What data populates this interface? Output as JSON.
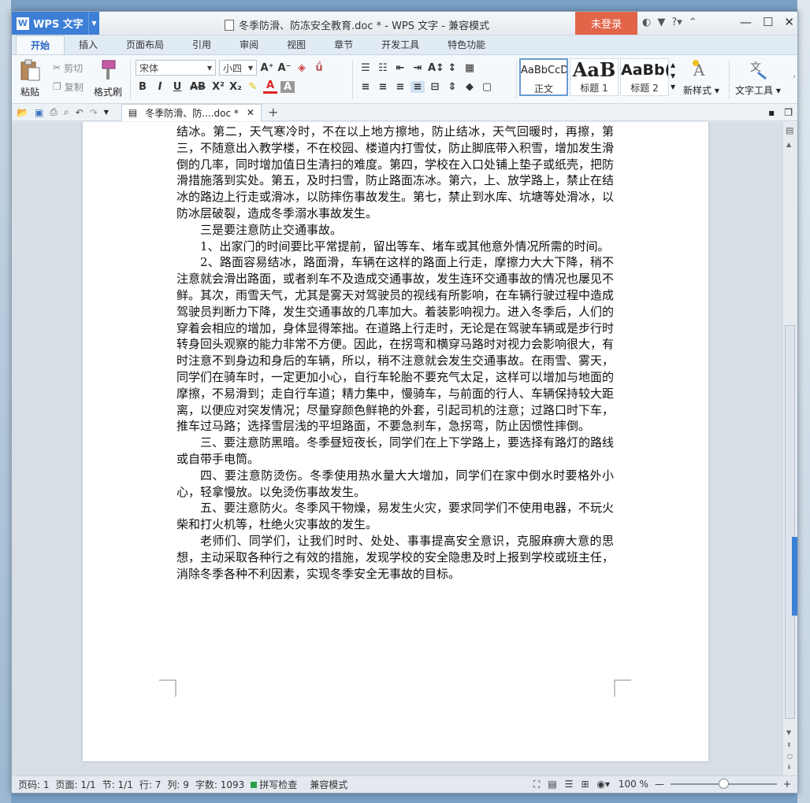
{
  "titlebar": {
    "app_name": "WPS 文字",
    "doc_title": "冬季防滑、防冻安全教育.doc * - WPS 文字 - 兼容模式",
    "login_label": "未登录",
    "help_label": "?"
  },
  "tabs": [
    "开始",
    "插入",
    "页面布局",
    "引用",
    "审阅",
    "视图",
    "章节",
    "开发工具",
    "特色功能"
  ],
  "ribbon": {
    "paste_label": "粘贴",
    "cut_label": "剪切",
    "copy_label": "复制",
    "format_painter_label": "格式刷",
    "font_name": "宋体",
    "font_size": "小四",
    "styles": [
      {
        "preview": "AaBbCcD",
        "name": "正文"
      },
      {
        "preview": "AaB",
        "name": "标题 1"
      },
      {
        "preview": "AaBb(",
        "name": "标题 2"
      }
    ],
    "new_style_label": "新样式",
    "text_tools_label": "文字工具"
  },
  "doc_tab": {
    "label": "冬季防滑、防....doc *"
  },
  "document": {
    "paragraphs": [
      {
        "text": "结冰。第二，天气寒冷时，不在以上地方擦地，防止结冰，天气回暖时，再擦，第三，不随意出入教学楼，不在校园、楼道内打雪仗，防止脚底带入积雪，增加发生滑倒的几率，同时增加值日生清扫的难度。第四，学校在入口处铺上垫子或纸壳，把防滑措施落到实处。第五，及时扫雪，防止路面冻冰。第六，上、放学路上，禁止在结冰的路边上行走或滑冰，以防摔伤事故发生。第七，禁止到水库、坑塘等处滑冰，以防冰层破裂，造成冬季溺水事故发生。",
        "indent": false
      },
      {
        "text": "三是要注意防止交通事故。",
        "indent": true
      },
      {
        "text": "1、出家门的时间要比平常提前，留出等车、堵车或其他意外情况所需的时间。",
        "indent": true
      },
      {
        "text": "2、路面容易结冰，路面滑，车辆在这样的路面上行走，摩擦力大大下降，稍不注意就会滑出路面，或者刹车不及造成交通事故，发生连环交通事故的情况也屡见不鲜。其次，雨雪天气，尤其是雾天对驾驶员的视线有所影响，在车辆行驶过程中造成驾驶员判断力下降，发生交通事故的几率加大。着装影响视力。进入冬季后，人们的穿着会相应的增加，身体显得笨拙。在道路上行走时，无论是在驾驶车辆或是步行时转身回头观察的能力非常不方便。因此，在拐弯和横穿马路时对视力会影响很大，有时注意不到身边和身后的车辆，所以，稍不注意就会发生交通事故。在雨雪、雾天，同学们在骑车时，一定更加小心，自行车轮胎不要充气太足，这样可以增加与地面的摩擦，不易滑到；走自行车道；精力集中，慢骑车，与前面的行人、车辆保持较大距离，以便应对突发情况；尽量穿颜色鲜艳的外套，引起司机的注意；过路口时下车，推车过马路；选择雪层浅的平坦路面，不要急刹车，急拐弯，防止因惯性摔倒。",
        "indent": true
      },
      {
        "text": "三、要注意防黑暗。冬季昼短夜长，同学们在上下学路上，要选择有路灯的路线或自带手电筒。",
        "indent": true
      },
      {
        "text": "四、要注意防烫伤。冬季使用热水量大大增加，同学们在家中倒水时要格外小心，轻拿慢放。以免烫伤事故发生。",
        "indent": true
      },
      {
        "text": "五、要注意防火。冬季风干物燥，易发生火灾，要求同学们不使用电器，不玩火柴和打火机等，杜绝火灾事故的发生。",
        "indent": true
      },
      {
        "text": "老师们、同学们，让我们时时、处处、事事提高安全意识，克服麻痹大意的思想，主动采取各种行之有效的措施，发现学校的安全隐患及时上报到学校或班主任，消除冬季各种不利因素，实现冬季安全无事故的目标。",
        "indent": true
      }
    ]
  },
  "statusbar": {
    "page_code": "页码: 1",
    "page": "页面: 1/1",
    "section": "节: 1/1",
    "row": "行: 7",
    "col": "列: 9",
    "word_count": "字数: 1093",
    "spell_check": "拼写检查",
    "compat_mode": "兼容模式",
    "zoom": "100 %"
  },
  "colors": {
    "app_blue": "#3d7ed6",
    "login_red": "#e2654a",
    "accent_blue": "#3b82d6"
  }
}
